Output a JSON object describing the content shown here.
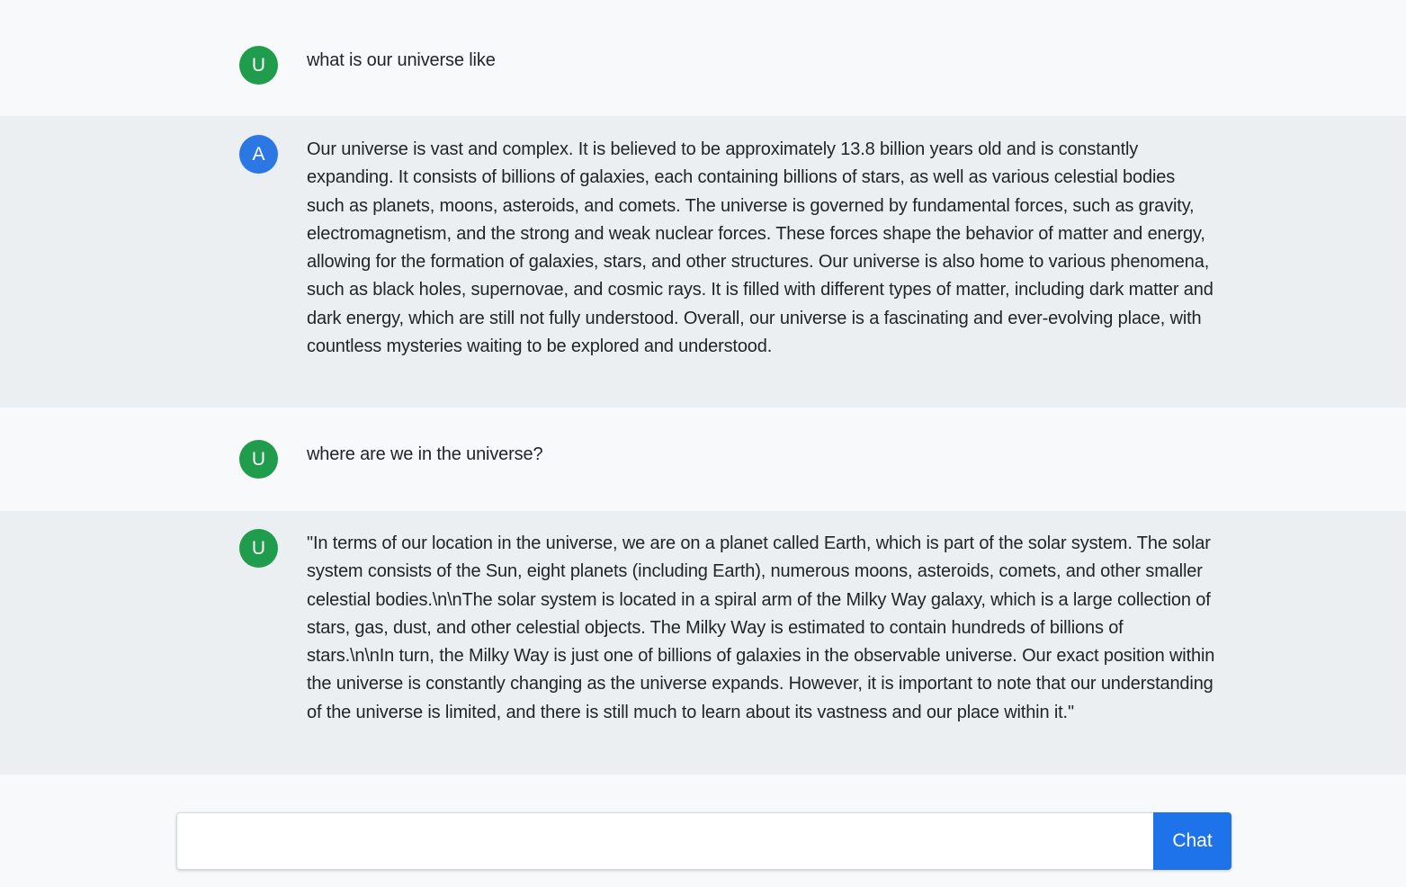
{
  "messages": [
    {
      "role": "user",
      "avatar": "U",
      "text": "what is our universe like"
    },
    {
      "role": "assistant",
      "avatar": "A",
      "text": "Our universe is vast and complex. It is believed to be approximately 13.8 billion years old and is constantly expanding. It consists of billions of galaxies, each containing billions of stars, as well as various celestial bodies such as planets, moons, asteroids, and comets. The universe is governed by fundamental forces, such as gravity, electromagnetism, and the strong and weak nuclear forces. These forces shape the behavior of matter and energy, allowing for the formation of galaxies, stars, and other structures. Our universe is also home to various phenomena, such as black holes, supernovae, and cosmic rays. It is filled with different types of matter, including dark matter and dark energy, which are still not fully understood. Overall, our universe is a fascinating and ever-evolving place, with countless mysteries waiting to be explored and understood."
    },
    {
      "role": "user",
      "avatar": "U",
      "text": "where are we in the universe?"
    },
    {
      "role": "user",
      "avatar": "U",
      "text": "\"In terms of our location in the universe, we are on a planet called Earth, which is part of the solar system. The solar system consists of the Sun, eight planets (including Earth), numerous moons, asteroids, comets, and other smaller celestial bodies.\\n\\nThe solar system is located in a spiral arm of the Milky Way galaxy, which is a large collection of stars, gas, dust, and other celestial objects. The Milky Way is estimated to contain hundreds of billions of stars.\\n\\nIn turn, the Milky Way is just one of billions of galaxies in the observable universe. Our exact position within the universe is constantly changing as the universe expands. However, it is important to note that our understanding of the universe is limited, and there is still much to learn about its vastness and our place within it.\""
    }
  ],
  "composer": {
    "input_value": "",
    "button_label": "Chat"
  },
  "colors": {
    "user_avatar": "#1f9d4c",
    "assistant_avatar": "#2b78e4",
    "button": "#1f73ea",
    "assistant_row_bg": "#eceff1",
    "page_bg": "#f8f9fa"
  }
}
